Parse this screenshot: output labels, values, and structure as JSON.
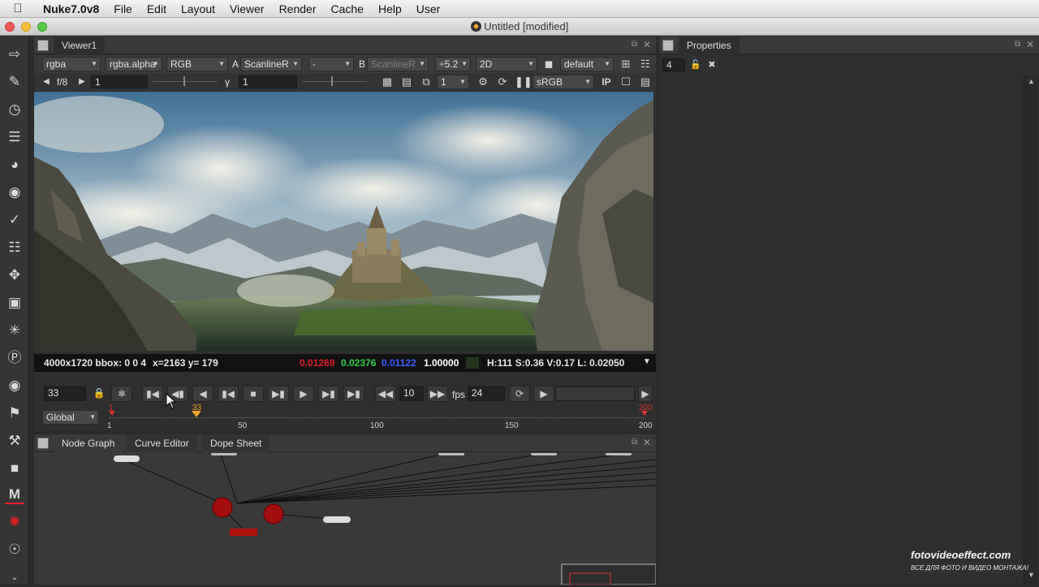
{
  "menubar": {
    "app_name": "Nuke7.0v8",
    "items": [
      "File",
      "Edit",
      "Layout",
      "Viewer",
      "Render",
      "Cache",
      "Help",
      "User"
    ]
  },
  "window": {
    "title": "Untitled [modified]"
  },
  "left_toolbar": {
    "icons": [
      "input-icon",
      "draw-icon",
      "time-icon",
      "channel-icon",
      "color-icon",
      "filter-icon",
      "keyer-icon",
      "merge-icon",
      "transform-icon",
      "3d-icon",
      "particles-icon",
      "deep-icon",
      "views-icon",
      "metadata-icon",
      "toolsets-icon",
      "other-icon",
      "m-icon",
      "furnace-icon",
      "nuke-icon",
      "expand-icon"
    ]
  },
  "viewer": {
    "tab_label": "Viewer1",
    "channels": "rgba",
    "alpha_channel": "rgba.alpha",
    "display_channel": "RGB",
    "input_a_label": "A",
    "input_a": "ScanlineR",
    "blend": "-",
    "input_b_label": "B",
    "input_b": "ScanlineR",
    "downscale": "÷5.2",
    "view_mode": "2D",
    "lut_preset": "default",
    "fstop": "f/8",
    "gain": "1",
    "gamma_label": "γ",
    "gamma": "1",
    "proxy": "1",
    "colorspace": "sRGB",
    "ip_label": "IP",
    "info": {
      "format": "4000x1720 bbox: 0 0 4",
      "coords": "x=2163 y= 179",
      "r": "0.01269",
      "g": "0.02376",
      "b": "0.01122",
      "a": "1.00000",
      "hsvl": "H:111 S:0.36 V:0.17  L: 0.02050"
    },
    "colors": {
      "r": "#e0202a",
      "g": "#2fd04a",
      "b": "#4060ff",
      "a": "#ffffff"
    },
    "transport": {
      "frame": "33",
      "increment": "10",
      "fps_label": "fps",
      "fps": "24"
    },
    "timeline": {
      "range_label": "Global",
      "start": "1",
      "end": "200",
      "current": "33",
      "ticks": [
        "1",
        "50",
        "100",
        "150",
        "200"
      ]
    }
  },
  "bottom_panel": {
    "tabs": [
      "Node Graph",
      "Curve Editor",
      "Dope Sheet"
    ]
  },
  "properties": {
    "tab_label": "Properties",
    "max_panels": "4"
  },
  "watermark": {
    "line1": "fotovideoeffect.com",
    "line2": "ВСЕ ДЛЯ ФОТО И ВИДЕО МОНТАЖА!"
  }
}
